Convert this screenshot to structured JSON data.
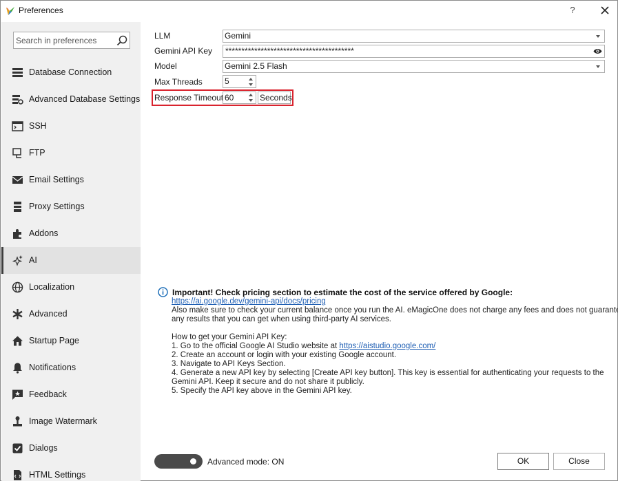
{
  "window": {
    "title": "Preferences",
    "help_label": "?",
    "close_label": "×"
  },
  "sidebar": {
    "search_placeholder": "Search in preferences",
    "items": [
      {
        "label": "Database Connection",
        "icon": "database-icon"
      },
      {
        "label": "Advanced Database Settings",
        "icon": "database-settings-icon"
      },
      {
        "label": "SSH",
        "icon": "terminal-icon"
      },
      {
        "label": "FTP",
        "icon": "ftp-icon"
      },
      {
        "label": "Email Settings",
        "icon": "envelope-icon"
      },
      {
        "label": "Proxy Settings",
        "icon": "proxy-icon"
      },
      {
        "label": "Addons",
        "icon": "puzzle-icon"
      },
      {
        "label": "AI",
        "icon": "sparkles-icon",
        "active": true
      },
      {
        "label": "Localization",
        "icon": "globe-icon"
      },
      {
        "label": "Advanced",
        "icon": "asterisk-icon"
      },
      {
        "label": "Startup Page",
        "icon": "home-icon"
      },
      {
        "label": "Notifications",
        "icon": "bell-icon"
      },
      {
        "label": "Feedback",
        "icon": "feedback-icon"
      },
      {
        "label": "Image Watermark",
        "icon": "watermark-icon"
      },
      {
        "label": "Dialogs",
        "icon": "checkbox-icon"
      },
      {
        "label": "HTML Settings",
        "icon": "html-icon"
      }
    ]
  },
  "form": {
    "llm_label": "LLM",
    "llm_value": "Gemini",
    "api_key_label": "Gemini API Key",
    "api_key_value": "****************************************",
    "model_label": "Model",
    "model_value": "Gemini 2.5 Flash",
    "threads_label": "Max Threads",
    "threads_value": "5",
    "timeout_label": "Response Timeout",
    "timeout_value": "60",
    "timeout_unit": "Seconds"
  },
  "info": {
    "heading": "Important! Check pricing section to estimate the cost of the service offered by Google:",
    "pricing_link": "https://ai.google.dev/gemini-api/docs/pricing",
    "line1": "Also make sure to check your current balance once you run the AI. eMagicOne does not charge any fees and does not guarantee",
    "line2": "any results that you can get when using third-party AI services.",
    "howto_title": "How to get your Gemini API Key:",
    "step1_text": "1. Go to the official Google AI Studio website at ",
    "step1_link": "https://aistudio.google.com/",
    "step2": "2. Create an account or login with your existing Google account.",
    "step3": "3. Navigate to API Keys Section.",
    "step4a": "4. Generate a new API key by selecting [Create API key button]. This key is essential for authenticating your requests to the",
    "step4b": "Gemini API. Keep it secure and do not share it publicly.",
    "step5": "5. Specify the API key above in the Gemini API key."
  },
  "footer": {
    "toggle_label": "Advanced mode: ON",
    "toggle_on": true,
    "ok_label": "OK",
    "close_label": "Close"
  },
  "colors": {
    "highlight": "#d9232e",
    "link": "#1f5fb4",
    "sidebar_bg": "#f0f0f0",
    "toggle_bg": "#4a4a4a",
    "info_icon": "#1f6fb8"
  }
}
